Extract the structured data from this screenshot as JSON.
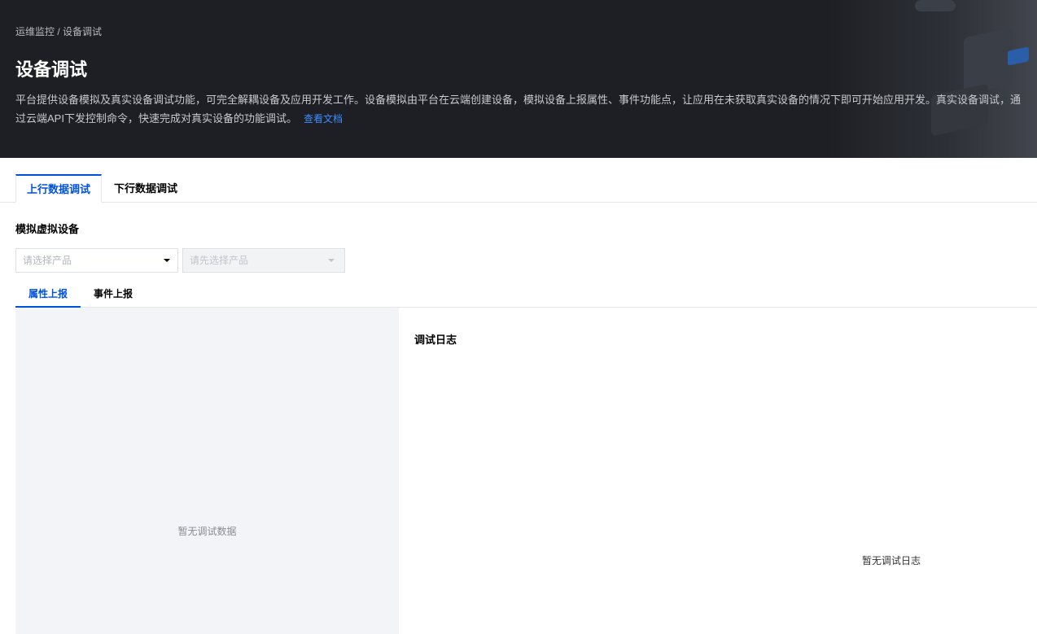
{
  "header": {
    "breadcrumb": "运维监控 / 设备调试",
    "title": "设备调试",
    "description": "平台提供设备模拟及真实设备调试功能，可完全解耦设备及应用开发工作。设备模拟由平台在云端创建设备，模拟设备上报属性、事件功能点，让应用在未获取真实设备的情况下即可开始应用开发。真实设备调试，通过云端API下发控制命令，快速完成对真实设备的功能调试。",
    "doc_link": "查看文档"
  },
  "main_tabs": [
    {
      "label": "上行数据调试",
      "active": true
    },
    {
      "label": "下行数据调试",
      "active": false
    }
  ],
  "section": {
    "title": "模拟虚拟设备"
  },
  "selects": {
    "product_placeholder": "请选择产品",
    "device_placeholder": "请先选择产品"
  },
  "sub_tabs": [
    {
      "label": "属性上报",
      "active": true
    },
    {
      "label": "事件上报",
      "active": false
    }
  ],
  "left_panel": {
    "empty_text": "暂无调试数据"
  },
  "right_panel": {
    "title": "调试日志",
    "empty_text": "暂无调试日志"
  },
  "colors": {
    "banner_bg": "#1d1f24",
    "accent": "#0052d9",
    "link": "#3e8cff",
    "panel_bg": "#f2f4f8"
  }
}
